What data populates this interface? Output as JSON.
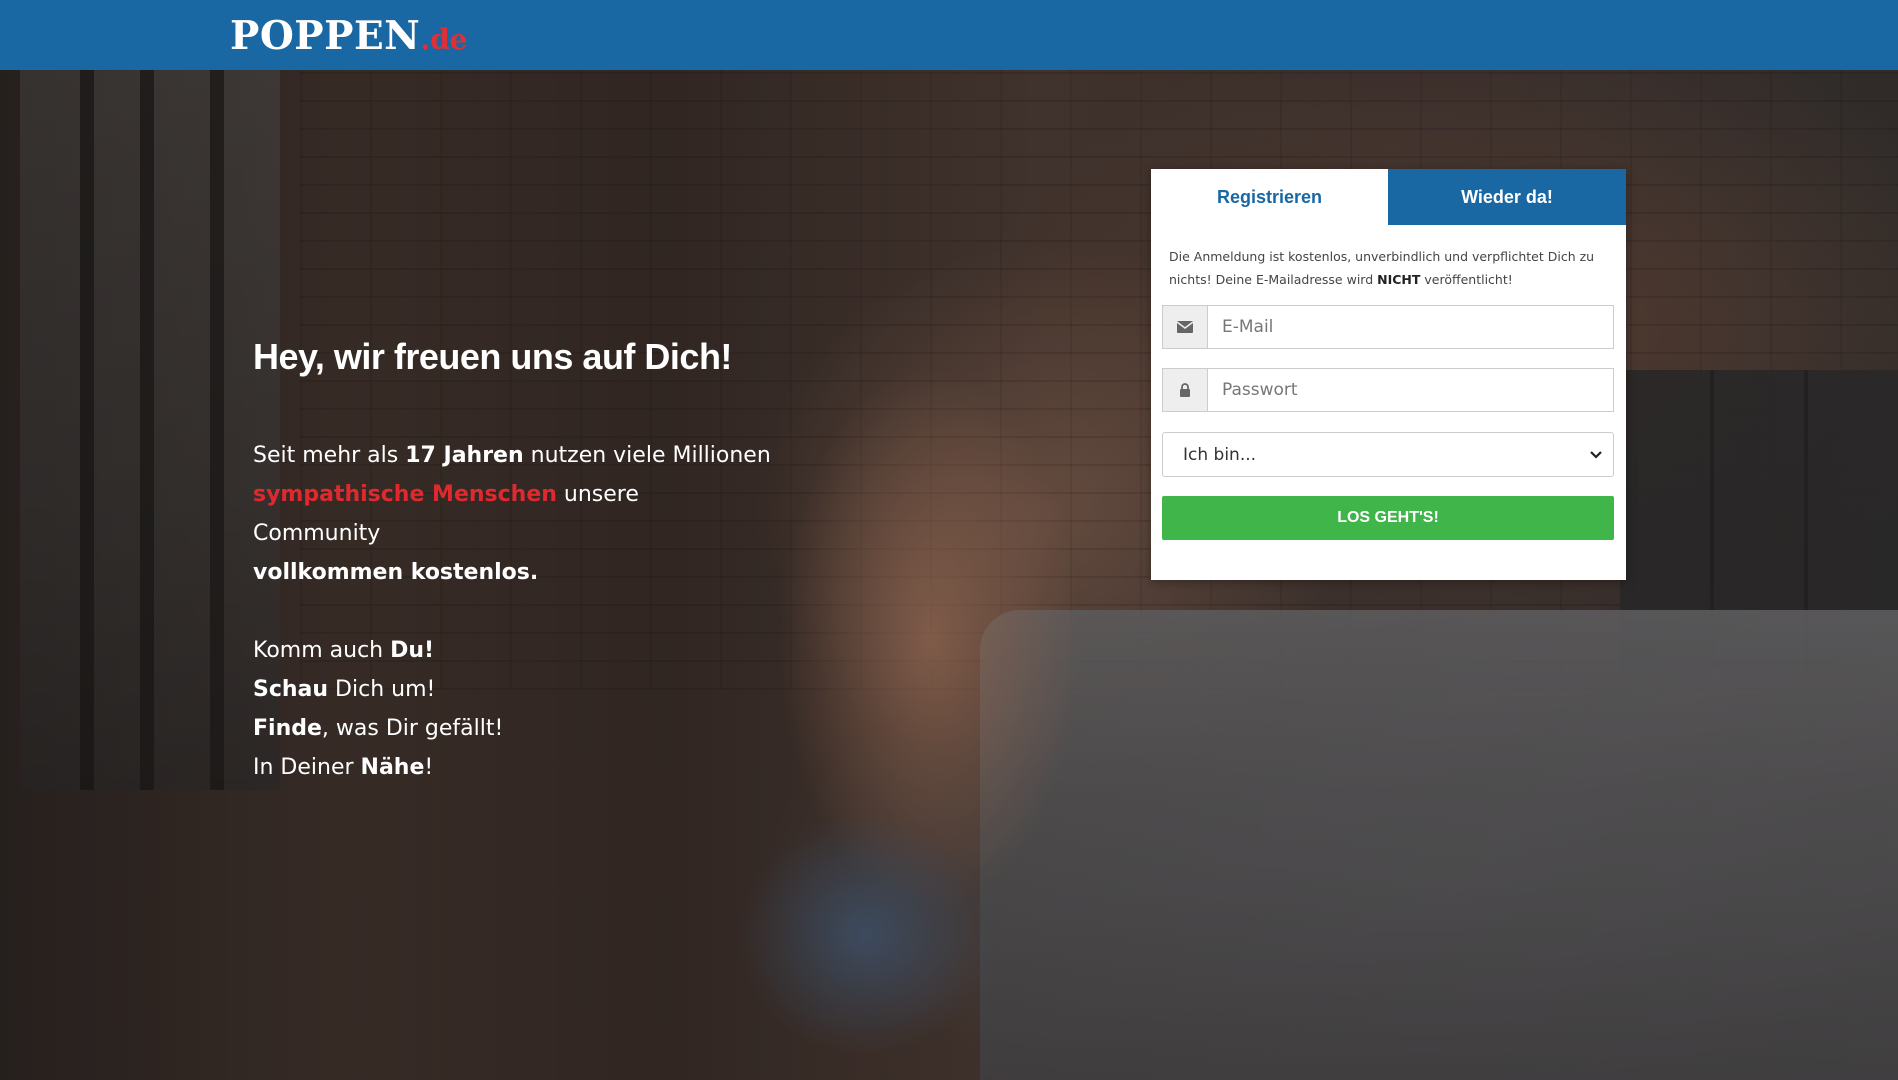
{
  "header": {
    "logo_main": "POPPEN",
    "logo_tld": ".de",
    "bg_color": "#1967a3"
  },
  "hero": {
    "headline": "Hey, wir freuen uns auf Dich!",
    "intro": {
      "t1": "Seit mehr als ",
      "t2": "17 Jahren",
      "t3": " nutzen viele Millionen",
      "t4": "sympathische Menschen",
      "t5": " unsere Community",
      "t6": "vollkommen kostenlos."
    },
    "lines": {
      "l1a": "Komm auch ",
      "l1b": "Du!",
      "l2a": "Schau",
      "l2b": " Dich um!",
      "l3a": "Finde",
      "l3b": ", was Dir gefällt!",
      "l4a": "In Deiner ",
      "l4b": "Nähe",
      "l4c": "!"
    },
    "accent_red": "#e0292e"
  },
  "form": {
    "tabs": {
      "register": "Registrieren",
      "login": "Wieder da!"
    },
    "note": {
      "n1": "Die Anmeldung ist kostenlos, unverbindlich und verpflichtet Dich zu nichts! Deine E-Mailadresse wird ",
      "n2": "NICHT",
      "n3": " veröffentlicht!"
    },
    "email": {
      "placeholder": "E-Mail",
      "icon": "envelope-icon"
    },
    "password": {
      "placeholder": "Passwort",
      "icon": "lock-icon"
    },
    "gender_select": {
      "selected": "Ich bin..."
    },
    "submit_label": "LOS GEHT'S!",
    "submit_color": "#3fb54a"
  }
}
